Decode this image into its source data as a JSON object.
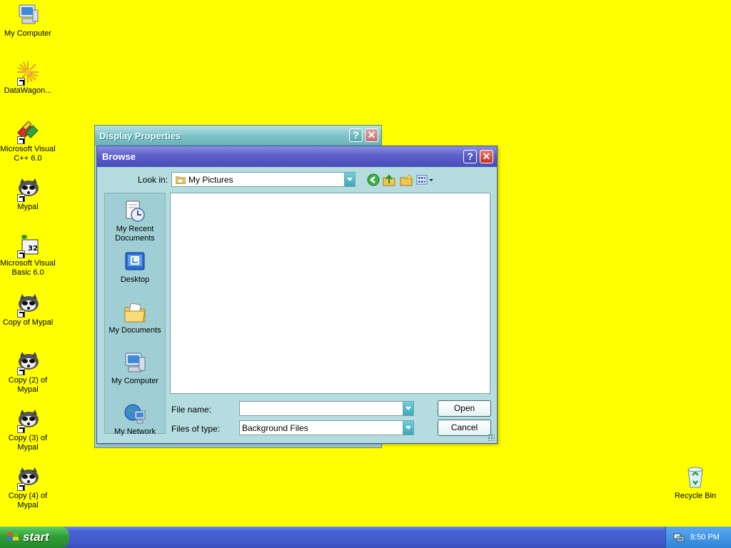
{
  "desktop": {
    "background_color": "#ffff00",
    "icons": [
      {
        "label": "My Computer",
        "icon": "my-computer-icon"
      },
      {
        "label": "DataWagon...",
        "icon": "datawagon-icon"
      },
      {
        "label": "Microsoft Visual C++ 6.0",
        "icon": "visual-cpp-icon"
      },
      {
        "label": "Mypal",
        "icon": "mypal-icon"
      },
      {
        "label": "Microsoft Visual Basic 6.0",
        "icon": "visual-basic-icon"
      },
      {
        "label": "Copy of Mypal",
        "icon": "mypal-icon"
      },
      {
        "label": "Copy (2) of Mypal",
        "icon": "mypal-icon"
      },
      {
        "label": "Copy (3) of Mypal",
        "icon": "mypal-icon"
      },
      {
        "label": "Copy (4) of Mypal",
        "icon": "mypal-icon"
      },
      {
        "label": "Recycle Bin",
        "icon": "recycle-bin-icon"
      }
    ]
  },
  "display_properties": {
    "title": "Display Properties"
  },
  "browse": {
    "title": "Browse",
    "look_in_label": "Look in:",
    "look_in_value": "My Pictures",
    "places": [
      {
        "label": "My Recent Documents",
        "icon": "recent-documents-icon"
      },
      {
        "label": "Desktop",
        "icon": "desktop-icon"
      },
      {
        "label": "My Documents",
        "icon": "my-documents-icon"
      },
      {
        "label": "My Computer",
        "icon": "my-computer-icon"
      },
      {
        "label": "My Network",
        "icon": "my-network-icon"
      }
    ],
    "file_name_label": "File name:",
    "file_name_value": "",
    "files_of_type_label": "Files of type:",
    "files_of_type_value": "Background Files",
    "open_label": "Open",
    "cancel_label": "Cancel"
  },
  "taskbar": {
    "start_label": "start",
    "clock": "8:50 PM"
  }
}
